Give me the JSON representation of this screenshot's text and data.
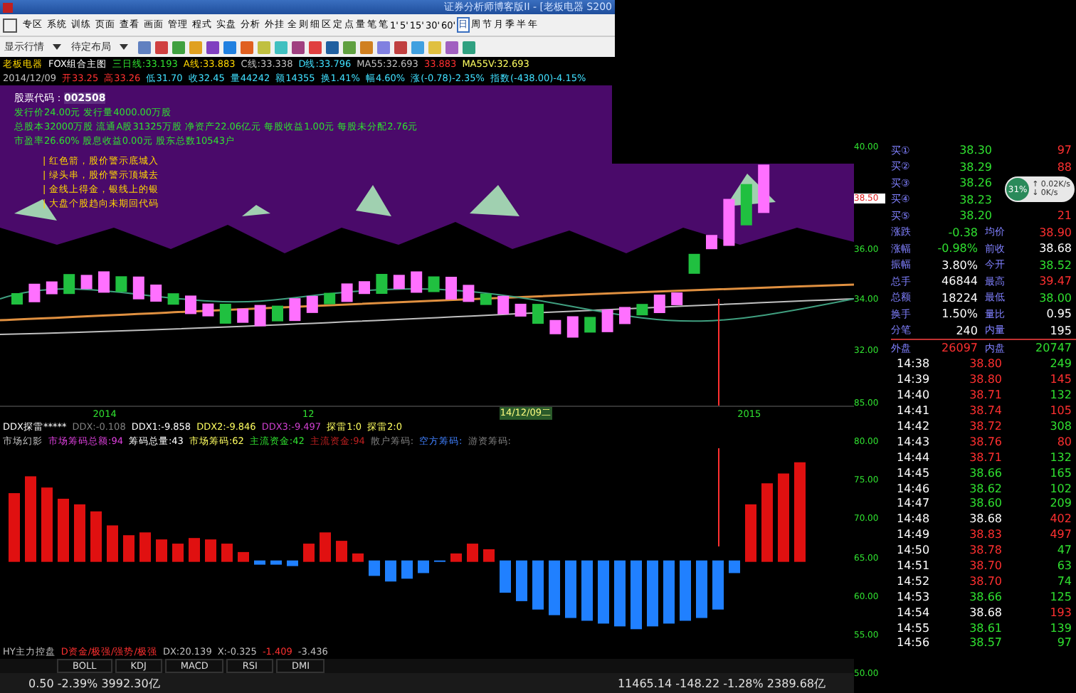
{
  "window": {
    "title": "证券分析师博客版II - [老板电器 S200"
  },
  "menu": [
    "专区",
    "系统",
    "训练",
    "页面",
    "查看",
    "画面",
    "管理",
    "程式",
    "实盘",
    "分析",
    "外挂"
  ],
  "view_buttons": [
    "全",
    "则",
    "细",
    "区",
    "定",
    "点",
    "量",
    "笔"
  ],
  "periods": [
    {
      "label": "笔",
      "selected": false
    },
    {
      "label": "1'",
      "selected": false
    },
    {
      "label": "5'",
      "selected": false
    },
    {
      "label": "15'",
      "selected": false
    },
    {
      "label": "30'",
      "selected": false
    },
    {
      "label": "60'",
      "selected": false
    },
    {
      "label": "日",
      "selected": true
    },
    {
      "label": "周",
      "selected": false
    },
    {
      "label": "节",
      "selected": false
    },
    {
      "label": "月",
      "selected": false
    },
    {
      "label": "季",
      "selected": false
    },
    {
      "label": "半",
      "selected": false
    },
    {
      "label": "年",
      "selected": false
    }
  ],
  "toolbar": {
    "dropdowns": [
      "显示行情",
      "待定布局"
    ]
  },
  "info_line": [
    {
      "text": "老板电器",
      "color": "#ffd700"
    },
    {
      "text": "FOX组合主图",
      "color": "#ffffff"
    },
    {
      "text": "三日线:33.193",
      "color": "#30e030"
    },
    {
      "text": "A线:33.883",
      "color": "#ffd700"
    },
    {
      "text": "C线:33.338",
      "color": "#c0c0c0"
    },
    {
      "text": "D线:33.796",
      "color": "#40e0ff"
    },
    {
      "text": "MA55:32.693",
      "color": "#c0c0c0"
    },
    {
      "text": "33.883",
      "color": "#ff3030"
    },
    {
      "text": "MA55V:32.693",
      "color": "#ffff60"
    }
  ],
  "quote_line": [
    {
      "text": "2014/12/09",
      "color": "#c0c0c0"
    },
    {
      "text": "开33.25",
      "color": "#ff3030"
    },
    {
      "text": "高33.26",
      "color": "#ff3030"
    },
    {
      "text": "低31.70",
      "color": "#40e0ff"
    },
    {
      "text": "收32.45",
      "color": "#40e0ff"
    },
    {
      "text": "量44242",
      "color": "#40e0ff"
    },
    {
      "text": "额14355",
      "color": "#40e0ff"
    },
    {
      "text": "换1.41%",
      "color": "#40e0ff"
    },
    {
      "text": "幅4.60%",
      "color": "#40e0ff"
    },
    {
      "text": "涨(-0.78)-2.35%",
      "color": "#40e0ff"
    },
    {
      "text": "指数(-438.00)-4.15%",
      "color": "#40e0ff"
    }
  ],
  "stock_info": {
    "code_label": "股票代码：",
    "code": "002508",
    "lines": [
      "发行价24.00元  发行量4000.00万股",
      "总股本32000万股  流通A股31325万股  净资产22.06亿元  每股收益1.00元  每股未分配2.76元",
      "市盈率26.60%  股息收益0.00元  股东总数10543户"
    ]
  },
  "legend": [
    "| 红色箭，股价警示底城入",
    "| 绿头串，股价警示顶城去",
    "| 金线上得金，银线上的银",
    "| 大盘个股趋向未期回代码"
  ],
  "price_axis": [
    "40.00",
    "36.00",
    "34.00",
    "32.00"
  ],
  "price_marker": "38.50",
  "x_axis": [
    {
      "text": "2014",
      "selected": false
    },
    {
      "text": "12",
      "selected": false
    },
    {
      "text": "14/12/09二",
      "selected": true
    },
    {
      "text": "2015",
      "selected": false
    }
  ],
  "ddx_line": [
    {
      "text": "DDX探雷*****",
      "color": "#ffffff"
    },
    {
      "text": "DDX:-0.108",
      "color": "#808080"
    },
    {
      "text": "DDX1:-9.858",
      "color": "#ffffff"
    },
    {
      "text": "DDX2:-9.846",
      "color": "#ffff60"
    },
    {
      "text": "DDX3:-9.497",
      "color": "#d040d0"
    },
    {
      "text": "探雷1:0",
      "color": "#ffff60"
    },
    {
      "text": "探雷2:0",
      "color": "#ffff60"
    }
  ],
  "chip_line": [
    {
      "text": "市场幻影",
      "color": "#c0c0c0"
    },
    {
      "text": "市场筹码总额:94",
      "color": "#e040e0"
    },
    {
      "text": "筹码总量:43",
      "color": "#ffffff"
    },
    {
      "text": "市场筹码:62",
      "color": "#ffff60"
    },
    {
      "text": "主流资金:42",
      "color": "#30e030"
    },
    {
      "text": "主流资金:94",
      "color": "#c02020"
    },
    {
      "text": "散户筹码:",
      "color": "#808080"
    },
    {
      "text": "空方筹码:",
      "color": "#4080ff"
    },
    {
      "text": "游资筹码:",
      "color": "#808080"
    }
  ],
  "hist_axis": [
    "85.00",
    "80.00",
    "75.00",
    "70.00",
    "65.00",
    "60.00",
    "55.00",
    "50.00"
  ],
  "order_book": [
    {
      "label": "买①",
      "price": "38.30",
      "volume": "97"
    },
    {
      "label": "买②",
      "price": "38.29",
      "volume": "88"
    },
    {
      "label": "买③",
      "price": "38.26"
    },
    {
      "label": "买④",
      "price": "38.23"
    },
    {
      "label": "买⑤",
      "price": "38.20",
      "volume": "21"
    }
  ],
  "gauge": {
    "percent": "31%",
    "up": "↑ 0.02K/s",
    "down": "↓ 0K/s"
  },
  "stats": [
    {
      "left": {
        "label": "涨跌",
        "value": "-0.38",
        "color": "#30e030"
      },
      "right": {
        "label": "均价",
        "value": "38.90",
        "color": "#ff3030"
      }
    },
    {
      "left": {
        "label": "涨幅",
        "value": "-0.98%",
        "color": "#30e030"
      },
      "right": {
        "label": "前收",
        "value": "38.68",
        "color": "#ffffff"
      }
    },
    {
      "left": {
        "label": "振幅",
        "value": "3.80%",
        "color": "#ffffff"
      },
      "right": {
        "label": "今开",
        "value": "38.52",
        "color": "#30e030"
      }
    },
    {
      "left": {
        "label": "总手",
        "value": "46844",
        "color": "#ffffff"
      },
      "right": {
        "label": "最高",
        "value": "39.47",
        "color": "#ff3030"
      }
    },
    {
      "left": {
        "label": "总额",
        "value": "18224",
        "color": "#ffffff"
      },
      "right": {
        "label": "最低",
        "value": "38.00",
        "color": "#30e030"
      }
    },
    {
      "left": {
        "label": "换手",
        "value": "1.50%",
        "color": "#ffffff"
      },
      "right": {
        "label": "量比",
        "value": "0.95",
        "color": "#ffffff"
      }
    },
    {
      "left": {
        "label": "分笔",
        "value": "240",
        "color": "#ffffff"
      },
      "right": {
        "label": "内量",
        "value": "195",
        "color": "#ffffff"
      }
    }
  ],
  "outer_inner": {
    "outer_label": "外盘",
    "outer": "26097",
    "inner_label": "内盘",
    "inner": "20747"
  },
  "ticks": [
    {
      "time": "14:38",
      "price": {
        "text": "38.80",
        "color": "#ff3030"
      },
      "volume": {
        "text": "249",
        "color": "#30e030"
      }
    },
    {
      "time": "14:39",
      "price": {
        "text": "38.80",
        "color": "#ff3030"
      },
      "volume": {
        "text": "145",
        "color": "#ff3030"
      }
    },
    {
      "time": "14:40",
      "price": {
        "text": "38.71",
        "color": "#ff3030"
      },
      "volume": {
        "text": "132",
        "color": "#30e030"
      }
    },
    {
      "time": "14:41",
      "price": {
        "text": "38.74",
        "color": "#ff3030"
      },
      "volume": {
        "text": "105",
        "color": "#ff3030"
      }
    },
    {
      "time": "14:42",
      "price": {
        "text": "38.72",
        "color": "#ff3030"
      },
      "volume": {
        "text": "308",
        "color": "#30e030"
      }
    },
    {
      "time": "14:43",
      "price": {
        "text": "38.76",
        "color": "#ff3030"
      },
      "volume": {
        "text": "80",
        "color": "#ff3030"
      }
    },
    {
      "time": "14:44",
      "price": {
        "text": "38.71",
        "color": "#ff3030"
      },
      "volume": {
        "text": "132",
        "color": "#30e030"
      }
    },
    {
      "time": "14:45",
      "price": {
        "text": "38.66",
        "color": "#30e030"
      },
      "volume": {
        "text": "165",
        "color": "#30e030"
      }
    },
    {
      "time": "14:46",
      "price": {
        "text": "38.62",
        "color": "#30e030"
      },
      "volume": {
        "text": "102",
        "color": "#30e030"
      }
    },
    {
      "time": "14:47",
      "price": {
        "text": "38.60",
        "color": "#30e030"
      },
      "volume": {
        "text": "209",
        "color": "#30e030"
      }
    },
    {
      "time": "14:48",
      "price": {
        "text": "38.68",
        "color": "#ffffff"
      },
      "volume": {
        "text": "402",
        "color": "#ff3030"
      }
    },
    {
      "time": "14:49",
      "price": {
        "text": "38.83",
        "color": "#ff3030"
      },
      "volume": {
        "text": "497",
        "color": "#ff3030"
      }
    },
    {
      "time": "14:50",
      "price": {
        "text": "38.78",
        "color": "#ff3030"
      },
      "volume": {
        "text": "47",
        "color": "#30e030"
      }
    },
    {
      "time": "14:51",
      "price": {
        "text": "38.70",
        "color": "#ff3030"
      },
      "volume": {
        "text": "63",
        "color": "#30e030"
      }
    },
    {
      "time": "14:52",
      "price": {
        "text": "38.70",
        "color": "#ff3030"
      },
      "volume": {
        "text": "74",
        "color": "#30e030"
      }
    },
    {
      "time": "14:53",
      "price": {
        "text": "38.66",
        "color": "#30e030"
      },
      "volume": {
        "text": "125",
        "color": "#30e030"
      }
    },
    {
      "time": "14:54",
      "price": {
        "text": "38.68",
        "color": "#ffffff"
      },
      "volume": {
        "text": "193",
        "color": "#ff3030"
      }
    },
    {
      "time": "14:55",
      "price": {
        "text": "38.61",
        "color": "#30e030"
      },
      "volume": {
        "text": "139",
        "color": "#30e030"
      }
    },
    {
      "time": "14:56",
      "price": {
        "text": "38.57",
        "color": "#30e030"
      },
      "volume": {
        "text": "97",
        "color": "#30e030"
      }
    }
  ],
  "hy_line": [
    {
      "text": "HY主力控盘",
      "color": "#c0c0c0"
    },
    {
      "text": "D资金/极强/强势/极强",
      "color": "#ff3030"
    },
    {
      "text": "DX:20.139",
      "color": "#c0c0c0"
    },
    {
      "text": "X:-0.325",
      "color": "#c0c0c0"
    },
    {
      "text": "-1.409",
      "color": "#ff3030"
    },
    {
      "text": "-3.436",
      "color": "#c0c0c0"
    }
  ],
  "indicator_tabs": [
    "BOLL",
    "KDJ",
    "MACD",
    "RSI",
    "DMI"
  ],
  "status_bar": {
    "left": "0.50  -2.39%  3992.30亿",
    "right": "11465.14  -148.22  -1.28%  2389.68亿"
  }
}
